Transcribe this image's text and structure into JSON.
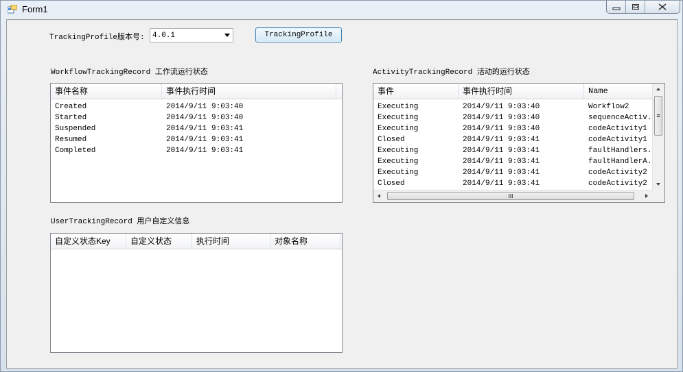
{
  "window": {
    "title": "Form1"
  },
  "caption": {
    "minimize": "—",
    "maximize": "□",
    "close": "╳"
  },
  "tracking": {
    "version_label": "TrackingProfile版本号:",
    "version_value": "4.0.1",
    "button_label": "TrackingProfile"
  },
  "workflow": {
    "group_label": "WorkflowTrackingRecord 工作流运行状态",
    "headers": [
      "事件名称",
      "事件执行时间"
    ],
    "rows": [
      [
        "Created",
        "2014/9/11 9:03:40"
      ],
      [
        "Started",
        "2014/9/11 9:03:40"
      ],
      [
        "Suspended",
        "2014/9/11 9:03:41"
      ],
      [
        "Resumed",
        "2014/9/11 9:03:41"
      ],
      [
        "Completed",
        "2014/9/11 9:03:41"
      ]
    ]
  },
  "activity": {
    "group_label": "ActivityTrackingRecord 活动的运行状态",
    "headers": [
      "事件",
      "事件执行时间",
      "Name"
    ],
    "rows": [
      [
        "Executing",
        "2014/9/11 9:03:40",
        "Workflow2"
      ],
      [
        "Executing",
        "2014/9/11 9:03:40",
        "sequenceActiv..."
      ],
      [
        "Executing",
        "2014/9/11 9:03:40",
        "codeActivity1"
      ],
      [
        "Closed",
        "2014/9/11 9:03:41",
        "codeActivity1"
      ],
      [
        "Executing",
        "2014/9/11 9:03:41",
        "faultHandlers..."
      ],
      [
        "Executing",
        "2014/9/11 9:03:41",
        "faultHandlerA..."
      ],
      [
        "Executing",
        "2014/9/11 9:03:41",
        "codeActivity2"
      ],
      [
        "Closed",
        "2014/9/11 9:03:41",
        "codeActivity2"
      ]
    ],
    "hscroll_grip": "III",
    "vscroll_grip": "≡"
  },
  "user": {
    "group_label": "UserTrackingRecord 用户自定义信息",
    "headers": [
      "自定义状态Key",
      "自定义状态",
      "执行时间",
      "对象名称"
    ]
  }
}
